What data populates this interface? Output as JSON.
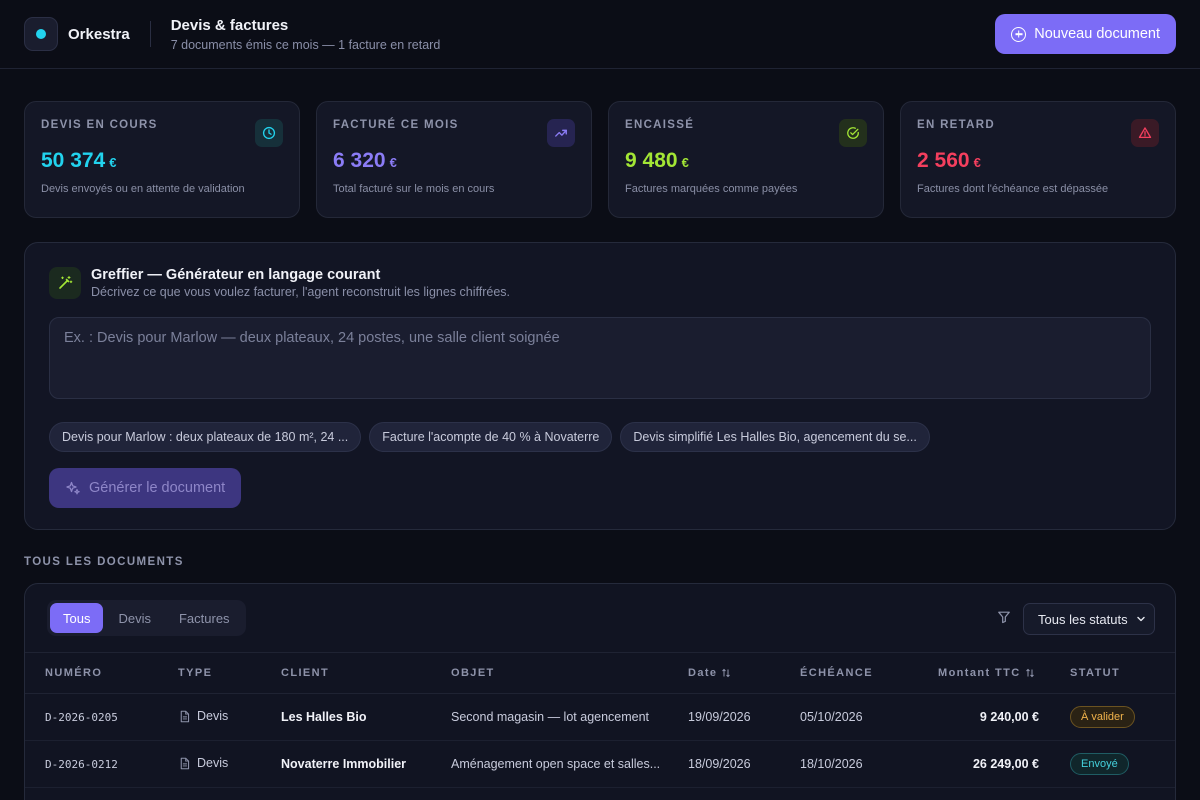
{
  "header": {
    "brand": "Orkestra",
    "title": "Devis & factures",
    "subtitle": "7 documents émis ce mois — 1 facture en retard",
    "new_button": "Nouveau document"
  },
  "kpis": [
    {
      "label": "DEVIS EN COURS",
      "value": "50 374",
      "currency": "€",
      "desc": "Devis envoyés ou en attente de validation",
      "color": "#22d3ee",
      "icon": "clock-icon"
    },
    {
      "label": "FACTURÉ CE MOIS",
      "value": "6 320",
      "currency": "€",
      "desc": "Total facturé sur le mois en cours",
      "color": "#8b7cf6",
      "icon": "trending-up-icon"
    },
    {
      "label": "ENCAISSÉ",
      "value": "9 480",
      "currency": "€",
      "desc": "Factures marquées comme payées",
      "color": "#a3e635",
      "icon": "check-circle-icon"
    },
    {
      "label": "EN RETARD",
      "value": "2 560",
      "currency": "€",
      "desc": "Factures dont l'échéance est dépassée",
      "color": "#f43f5e",
      "icon": "alert-triangle-icon"
    }
  ],
  "generator": {
    "title": "Greffier — Générateur en langage courant",
    "subtitle": "Décrivez ce que vous voulez facturer, l'agent reconstruit les lignes chiffrées.",
    "placeholder": "Ex. : Devis pour Marlow — deux plateaux, 24 postes, une salle client soignée",
    "chips": [
      "Devis pour Marlow : deux plateaux de 180 m², 24 ...",
      "Facture l'acompte de 40 % à Novaterre",
      "Devis simplifié Les Halles Bio, agencement du se..."
    ],
    "generate_button": "Générer le document"
  },
  "documents": {
    "section_label": "TOUS LES DOCUMENTS",
    "tabs": [
      "Tous",
      "Devis",
      "Factures"
    ],
    "status_filter": "Tous les statuts",
    "columns": {
      "numero": "NUMÉRO",
      "type": "TYPE",
      "client": "CLIENT",
      "objet": "OBJET",
      "date": "Date",
      "echeance": "ÉCHÉANCE",
      "montant": "Montant TTC",
      "statut": "STATUT"
    },
    "rows": [
      {
        "numero": "D-2026-0205",
        "type": "Devis",
        "client": "Les Halles Bio",
        "objet": "Second magasin — lot agencement",
        "date": "19/09/2026",
        "echeance": "05/10/2026",
        "montant": "9 240,00 €",
        "statut": "À valider"
      },
      {
        "numero": "D-2026-0212",
        "type": "Devis",
        "client": "Novaterre Immobilier",
        "objet": "Aménagement open space et salles...",
        "date": "18/09/2026",
        "echeance": "18/10/2026",
        "montant": "26 249,00 €",
        "statut": "Envoyé"
      }
    ]
  }
}
